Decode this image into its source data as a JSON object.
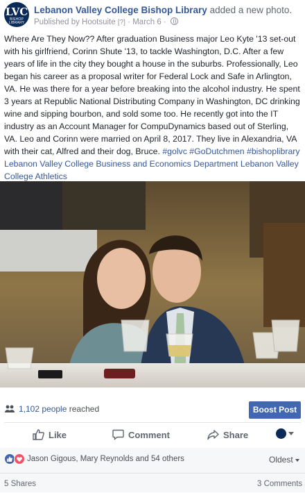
{
  "header": {
    "page_name": "Lebanon Valley College Bishop Library",
    "action": "added a new photo.",
    "published_by": "Published by Hootsuite",
    "help_mark": "[?]",
    "separator": "·",
    "date": "March 6",
    "separator2": "·",
    "avatar_monogram": "LVC",
    "avatar_subtext": "BISHOP LIBRARY"
  },
  "caption": {
    "text": "Where Are They Now?? After graduation Business major Leo Kyte '13 set-out with his girlfriend, Corinn Shute '13, to tackle Washington, D.C. After a few years of life in the city they bought a house in the suburbs. Professionally, Leo began his career as a proposal writer for Federal Lock and Safe in Arlington, VA. He was there for a year before breaking into the alcohol industry. He spent 3 years at Republic National Distributing Company in Washington, DC drinking wine and sipping bourbon, and sold some too. He recently got into the IT industry as an Account Manager for CompuDynamics based out of Sterling, VA. Leo and Corinn were married on April 8, 2017. They live in Alexandria, VA with their cat, Alfred and their dog, Bruce.",
    "hashtag1": "#golvc",
    "hashtag2": "#GoDutchmen",
    "hashtag3": "#bishoplibrary",
    "tag1": "Lebanon Valley College",
    "tag2": "Business and Economics Department",
    "tag3": "Lebanon Valley College Athletics"
  },
  "stats": {
    "reach_count": "1,102 people",
    "reach_label": "reached",
    "boost_label": "Boost Post"
  },
  "actions": {
    "like": "Like",
    "comment": "Comment",
    "share": "Share"
  },
  "reactions": {
    "names": "Jason Gigous, Mary Reynolds and 54 others",
    "sort": "Oldest",
    "shares": "5 Shares",
    "comments": "3 Comments"
  },
  "colors": {
    "link": "#365899",
    "boost": "#4267b2",
    "love": "#f25268"
  },
  "icons": {
    "reach": "people-icon",
    "like": "thumbs-up-icon",
    "comment": "speech-bubble-icon",
    "share": "share-arrow-icon",
    "visibility": "globe-icon"
  }
}
